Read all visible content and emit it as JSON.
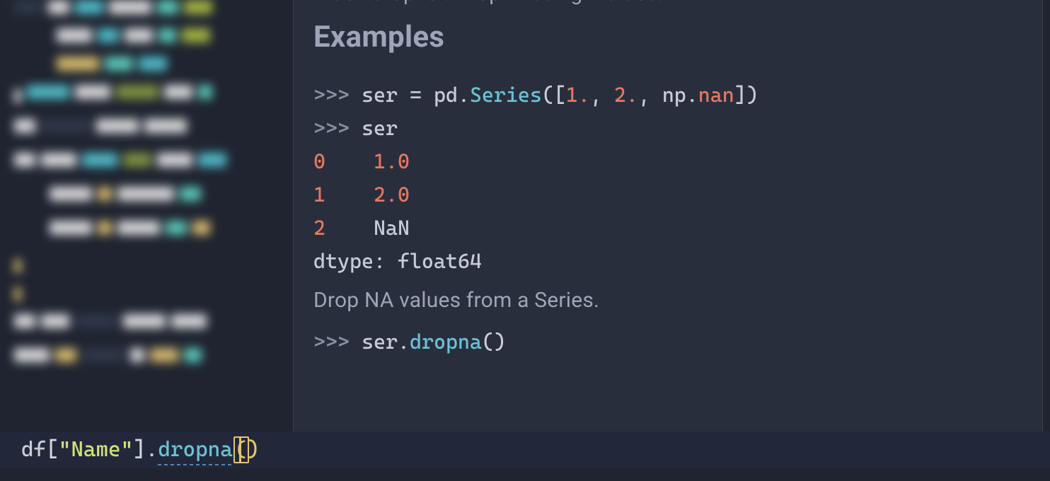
{
  "doc": {
    "top_line": "Index.dropna : Drop missing indices.",
    "heading": "Examples",
    "prompt": ">>>",
    "ex1": {
      "var": "ser",
      "eq": " = ",
      "mod": "pd",
      "fn": "Series",
      "args_open": "([",
      "n1": "1.",
      "c1": ", ",
      "n2": "2.",
      "c2": ", ",
      "np": "np",
      "nan": "nan",
      "args_close": "])"
    },
    "ex2": "ser",
    "out": [
      {
        "idx": "0",
        "val": "1.0"
      },
      {
        "idx": "1",
        "val": "2.0"
      },
      {
        "idx": "2",
        "val": "NaN"
      }
    ],
    "dtype": "dtype: float64",
    "note": "Drop NA values from a Series.",
    "ex3": {
      "obj": "ser",
      "fn": "dropna",
      "call": "()"
    }
  },
  "editor": {
    "df": "df",
    "open": "[",
    "q1": "\"",
    "str": "Name",
    "q2": "\"",
    "close": "]",
    "dot": ".",
    "method": "dropna",
    "paren_open": "(",
    "paren_close": ")"
  }
}
